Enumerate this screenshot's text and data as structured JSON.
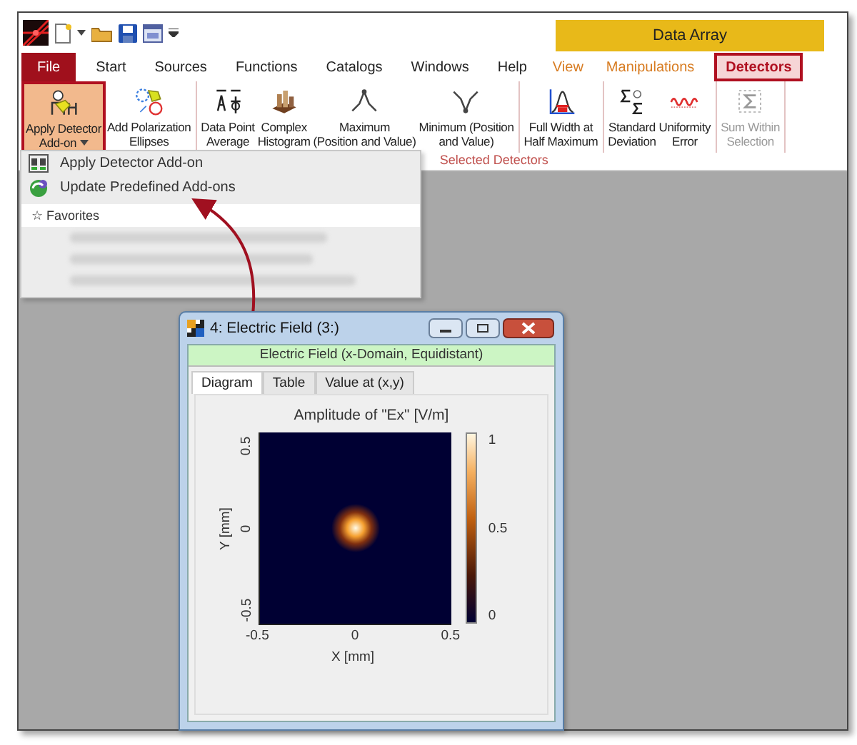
{
  "contextual_header": {
    "title": "Data Array"
  },
  "tabs": [
    {
      "label": "File",
      "kind": "file",
      "selected": false
    },
    {
      "label": "Start",
      "kind": "normal",
      "selected": false
    },
    {
      "label": "Sources",
      "kind": "normal",
      "selected": false
    },
    {
      "label": "Functions",
      "kind": "normal",
      "selected": false
    },
    {
      "label": "Catalogs",
      "kind": "normal",
      "selected": false
    },
    {
      "label": "Windows",
      "kind": "normal",
      "selected": false
    },
    {
      "label": "Help",
      "kind": "normal",
      "selected": false
    },
    {
      "label": "View",
      "kind": "contextual",
      "selected": false
    },
    {
      "label": "Manipulations",
      "kind": "contextual",
      "selected": false
    },
    {
      "label": "Detectors",
      "kind": "contextual",
      "selected": true
    }
  ],
  "ribbon": {
    "buttons": [
      {
        "lines": [
          "Apply Detector",
          "Add-on"
        ],
        "dropdown": true,
        "selected": true,
        "disabled": false,
        "separator_after": false
      },
      {
        "lines": [
          "Add Polarization",
          "Ellipses"
        ],
        "dropdown": false,
        "selected": false,
        "disabled": false,
        "separator_after": true
      },
      {
        "lines": [
          "Data Point",
          "Average"
        ],
        "dropdown": false,
        "selected": false,
        "disabled": false,
        "separator_after": false
      },
      {
        "lines": [
          "Complex",
          "Histogram"
        ],
        "dropdown": false,
        "selected": false,
        "disabled": false,
        "separator_after": false
      },
      {
        "lines": [
          "Maximum",
          "(Position and Value)"
        ],
        "dropdown": false,
        "selected": false,
        "disabled": false,
        "separator_after": false
      },
      {
        "lines": [
          "Minimum (Position",
          "and Value)"
        ],
        "dropdown": false,
        "selected": false,
        "disabled": false,
        "separator_after": true
      },
      {
        "lines": [
          "Full Width at",
          "Half Maximum"
        ],
        "dropdown": false,
        "selected": false,
        "disabled": false,
        "separator_after": true
      },
      {
        "lines": [
          "Standard",
          "Deviation"
        ],
        "dropdown": false,
        "selected": false,
        "disabled": false,
        "separator_after": false
      },
      {
        "lines": [
          "Uniformity",
          "Error"
        ],
        "dropdown": false,
        "selected": false,
        "disabled": false,
        "separator_after": true
      },
      {
        "lines": [
          "Sum Within",
          "Selection"
        ],
        "dropdown": false,
        "selected": false,
        "disabled": true,
        "separator_after": true
      }
    ],
    "group_label": "Selected Detectors"
  },
  "dropdown_menu": {
    "items": [
      {
        "label": "Apply Detector Add-on"
      },
      {
        "label": "Update Predefined Add-ons"
      }
    ],
    "favorites_header": "☆ Favorites",
    "favorites": [
      {
        "blurred": true
      },
      {
        "blurred": true
      },
      {
        "blurred": true
      }
    ]
  },
  "child_window": {
    "title": "4: Electric Field (3:)",
    "subtitle": "Electric Field (x-Domain, Equidistant)",
    "tabs": [
      {
        "label": "Diagram",
        "selected": true
      },
      {
        "label": "Table",
        "selected": false
      },
      {
        "label": "Value at (x,y)",
        "selected": false
      }
    ],
    "plot": {
      "title": "Amplitude of \"Ex\"  [V/m]",
      "xlabel": "X [mm]",
      "ylabel": "Y [mm]",
      "xticks": [
        "-0.5",
        "0",
        "0.5"
      ],
      "yticks": [
        "0.5",
        "0",
        "-0.5"
      ],
      "colorbar_ticks": [
        "1",
        "0.5",
        "0"
      ]
    }
  }
}
